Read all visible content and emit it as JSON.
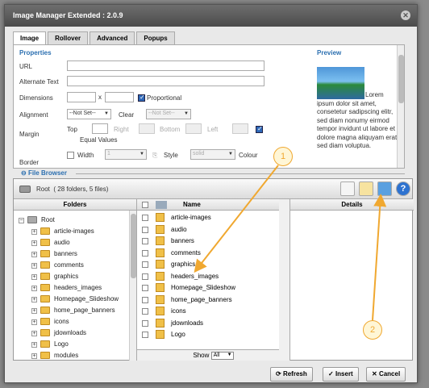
{
  "window": {
    "title": "Image Manager Extended : 2.0.9"
  },
  "tabs": [
    {
      "label": "Image",
      "active": true
    },
    {
      "label": "Rollover"
    },
    {
      "label": "Advanced"
    },
    {
      "label": "Popups"
    }
  ],
  "properties": {
    "section_title": "Properties",
    "url_label": "URL",
    "alt_label": "Alternate Text",
    "dimensions_label": "Dimensions",
    "dim_x": "x",
    "proportional_label": "Proportional",
    "alignment_label": "Alignment",
    "alignment_value": "--Not Set--",
    "clear_label": "Clear",
    "clear_value": "--Not Set--",
    "margin_label": "Margin",
    "margin_top": "Top",
    "margin_right": "Right",
    "margin_bottom": "Bottom",
    "margin_left": "Left",
    "equal_values_label": "Equal Values",
    "border_label": "Border",
    "width_label": "Width",
    "width_value": "1",
    "style_label": "Style",
    "style_value": "solid",
    "colour_label": "Colour"
  },
  "preview": {
    "section_title": "Preview",
    "text": "Lorem ipsum dolor sit amet, consetetur sadipscing elitr, sed diam nonumy eirmod tempor invidunt ut labore et dolore magna aliquyam erat, sed diam voluptua."
  },
  "file_browser": {
    "section_title": "File Browser",
    "root_label": "Root",
    "root_info": "( 28 folders, 5 files)",
    "folders_header": "Folders",
    "name_header": "Name",
    "details_header": "Details",
    "tree_root": "Root",
    "tree": [
      "article-images",
      "audio",
      "banners",
      "comments",
      "graphics",
      "headers_images",
      "Homepage_Slideshow",
      "home_page_banners",
      "icons",
      "jdownloads",
      "Logo",
      "modules"
    ],
    "files": [
      "article-images",
      "audio",
      "banners",
      "comments",
      "graphics",
      "headers_images",
      "Homepage_Slideshow",
      "home_page_banners",
      "icons",
      "jdownloads",
      "Logo"
    ],
    "show_label": "Show",
    "show_value": "All",
    "help_glyph": "?"
  },
  "buttons": {
    "refresh": "Refresh",
    "insert": "Insert",
    "cancel": "Cancel"
  },
  "callouts": {
    "one": "1",
    "two": "2"
  }
}
